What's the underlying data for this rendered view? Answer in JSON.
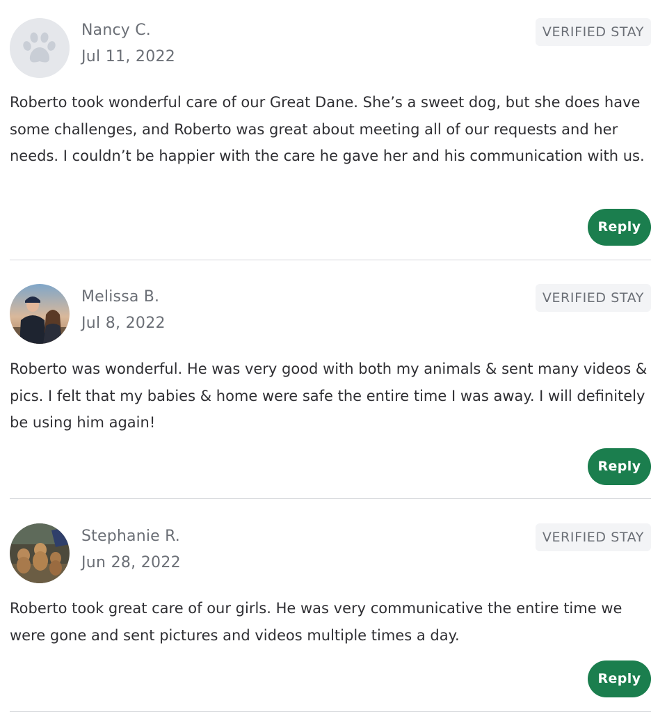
{
  "reviews": [
    {
      "avatar": "paw-icon",
      "name": "Nancy C.",
      "date": "Jul 11, 2022",
      "badge": "VERIFIED STAY",
      "text": "Roberto took wonderful care of our Great Dane. She’s a sweet dog, but she does have some challenges, and Roberto was great about meeting all of our requests and her needs. I couldn’t be happier with the care he gave her and his communication with us.",
      "reply_label": "Reply"
    },
    {
      "avatar": "user-photo",
      "name": "Melissa B.",
      "date": "Jul 8, 2022",
      "badge": "VERIFIED STAY",
      "text": "Roberto was wonderful. He was very good with both my animals & sent many videos & pics. I felt that my babies & home were safe the entire time I was away. I will definitely be using him again!",
      "reply_label": "Reply"
    },
    {
      "avatar": "user-photo",
      "name": "Stephanie R.",
      "date": "Jun 28, 2022",
      "badge": "VERIFIED STAY",
      "text": "Roberto took great care of our girls. He was very communicative the entire time we were gone and sent pictures and videos multiple times a day.",
      "reply_label": "Reply"
    }
  ],
  "colors": {
    "accent": "#1b7e4e",
    "badge_bg": "#f3f4f6",
    "divider": "#d4d6da"
  }
}
